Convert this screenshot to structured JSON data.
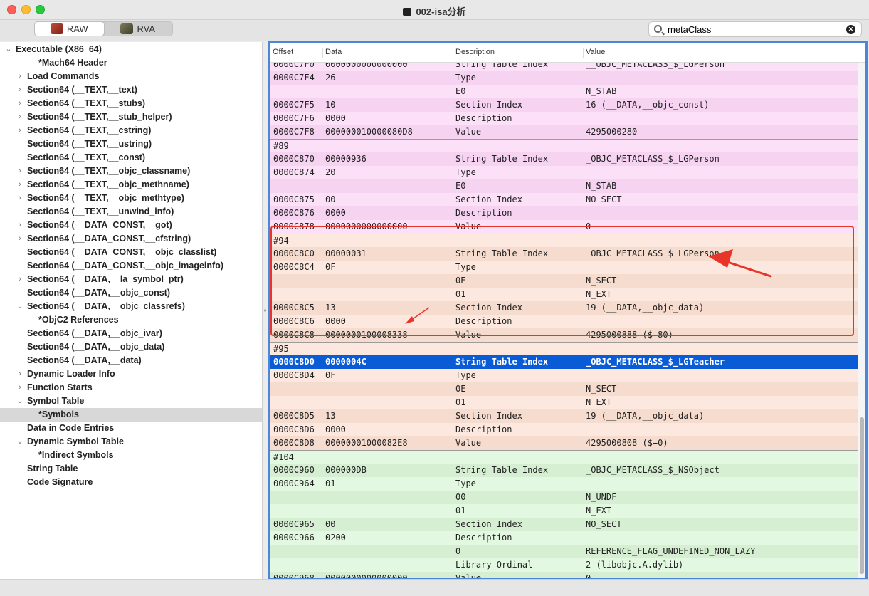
{
  "window": {
    "title": "002-isa分析"
  },
  "toolbar": {
    "raw_label": "RAW",
    "rva_label": "RVA",
    "search_value": "metaClass"
  },
  "columns": [
    "Offset",
    "Data",
    "Description",
    "Value"
  ],
  "sidebar": {
    "items": [
      {
        "label": "Executable  (X86_64)",
        "level": 0,
        "disc": "v"
      },
      {
        "label": "*Mach64 Header",
        "level": 2,
        "disc": ""
      },
      {
        "label": "Load Commands",
        "level": 1,
        "disc": ">"
      },
      {
        "label": "Section64 (__TEXT,__text)",
        "level": 1,
        "disc": ">"
      },
      {
        "label": "Section64 (__TEXT,__stubs)",
        "level": 1,
        "disc": ">"
      },
      {
        "label": "Section64 (__TEXT,__stub_helper)",
        "level": 1,
        "disc": ">"
      },
      {
        "label": "Section64 (__TEXT,__cstring)",
        "level": 1,
        "disc": ">"
      },
      {
        "label": "Section64 (__TEXT,__ustring)",
        "level": 1,
        "disc": ""
      },
      {
        "label": "Section64 (__TEXT,__const)",
        "level": 1,
        "disc": ""
      },
      {
        "label": "Section64 (__TEXT,__objc_classname)",
        "level": 1,
        "disc": ">"
      },
      {
        "label": "Section64 (__TEXT,__objc_methname)",
        "level": 1,
        "disc": ">"
      },
      {
        "label": "Section64 (__TEXT,__objc_methtype)",
        "level": 1,
        "disc": ">"
      },
      {
        "label": "Section64 (__TEXT,__unwind_info)",
        "level": 1,
        "disc": ""
      },
      {
        "label": "Section64 (__DATA_CONST,__got)",
        "level": 1,
        "disc": ">"
      },
      {
        "label": "Section64 (__DATA_CONST,__cfstring)",
        "level": 1,
        "disc": ">"
      },
      {
        "label": "Section64 (__DATA_CONST,__objc_classlist)",
        "level": 1,
        "disc": ""
      },
      {
        "label": "Section64 (__DATA_CONST,__objc_imageinfo)",
        "level": 1,
        "disc": ""
      },
      {
        "label": "Section64 (__DATA,__la_symbol_ptr)",
        "level": 1,
        "disc": ">"
      },
      {
        "label": "Section64 (__DATA,__objc_const)",
        "level": 1,
        "disc": ""
      },
      {
        "label": "Section64 (__DATA,__objc_classrefs)",
        "level": 1,
        "disc": "v"
      },
      {
        "label": "*ObjC2 References",
        "level": 2,
        "disc": ""
      },
      {
        "label": "Section64 (__DATA,__objc_ivar)",
        "level": 1,
        "disc": ""
      },
      {
        "label": "Section64 (__DATA,__objc_data)",
        "level": 1,
        "disc": ""
      },
      {
        "label": "Section64 (__DATA,__data)",
        "level": 1,
        "disc": ""
      },
      {
        "label": "Dynamic Loader Info",
        "level": 1,
        "disc": ">"
      },
      {
        "label": "Function Starts",
        "level": 1,
        "disc": ">"
      },
      {
        "label": "Symbol Table",
        "level": 1,
        "disc": "v"
      },
      {
        "label": "*Symbols",
        "level": 2,
        "disc": "",
        "selected": true
      },
      {
        "label": "Data in Code Entries",
        "level": 1,
        "disc": ""
      },
      {
        "label": "Dynamic Symbol Table",
        "level": 1,
        "disc": "v"
      },
      {
        "label": "*Indirect Symbols",
        "level": 2,
        "disc": ""
      },
      {
        "label": "String Table",
        "level": 1,
        "disc": ""
      },
      {
        "label": "Code Signature",
        "level": 1,
        "disc": ""
      }
    ]
  },
  "rows": [
    {
      "o": "0000C7F0",
      "d": "0000000000000000",
      "desc": "String Table Index",
      "v": "__OBJC_METACLASS_$_LGPerson",
      "bg": "pink"
    },
    {
      "o": "0000C7F4",
      "d": "26",
      "desc": "Type",
      "v": "",
      "bg": "pink"
    },
    {
      "o": "",
      "d": "",
      "desc": "E0",
      "v": "N_STAB",
      "bg": "pink"
    },
    {
      "o": "0000C7F5",
      "d": "10",
      "desc": "Section Index",
      "v": "16 (__DATA,__objc_const)",
      "bg": "pink"
    },
    {
      "o": "0000C7F6",
      "d": "0000",
      "desc": "Description",
      "v": "",
      "bg": "pink"
    },
    {
      "o": "0000C7F8",
      "d": "000000010000080D8",
      "desc": "Value",
      "v": "4295000280",
      "bg": "pink"
    },
    {
      "o": "#89",
      "d": "",
      "desc": "",
      "v": "",
      "bg": "pink",
      "sep": true
    },
    {
      "o": "0000C870",
      "d": "00000936",
      "desc": "String Table Index",
      "v": "_OBJC_METACLASS_$_LGPerson",
      "bg": "pink"
    },
    {
      "o": "0000C874",
      "d": "20",
      "desc": "Type",
      "v": "",
      "bg": "pink"
    },
    {
      "o": "",
      "d": "",
      "desc": "E0",
      "v": "N_STAB",
      "bg": "pink"
    },
    {
      "o": "0000C875",
      "d": "00",
      "desc": "Section Index",
      "v": "NO_SECT",
      "bg": "pink"
    },
    {
      "o": "0000C876",
      "d": "0000",
      "desc": "Description",
      "v": "",
      "bg": "pink"
    },
    {
      "o": "0000C878",
      "d": "0000000000000000",
      "desc": "Value",
      "v": "0",
      "bg": "pink"
    },
    {
      "o": "#94",
      "d": "",
      "desc": "",
      "v": "",
      "bg": "peach",
      "sep": true
    },
    {
      "o": "0000C8C0",
      "d": "00000031",
      "desc": "String Table Index",
      "v": "_OBJC_METACLASS_$_LGPerson",
      "bg": "peach"
    },
    {
      "o": "0000C8C4",
      "d": "0F",
      "desc": "Type",
      "v": "",
      "bg": "peach"
    },
    {
      "o": "",
      "d": "",
      "desc": "0E",
      "v": "N_SECT",
      "bg": "peach"
    },
    {
      "o": "",
      "d": "",
      "desc": "01",
      "v": "N_EXT",
      "bg": "peach"
    },
    {
      "o": "0000C8C5",
      "d": "13",
      "desc": "Section Index",
      "v": "19 (__DATA,__objc_data)",
      "bg": "peach"
    },
    {
      "o": "0000C8C6",
      "d": "0000",
      "desc": "Description",
      "v": "",
      "bg": "peach"
    },
    {
      "o": "0000C8C8",
      "d": "0000000100008338",
      "desc": "Value",
      "v": "4295000888 ($+80)",
      "bg": "peach"
    },
    {
      "o": "#95",
      "d": "",
      "desc": "",
      "v": "",
      "bg": "peach",
      "sep": true
    },
    {
      "o": "0000C8D0",
      "d": "0000004C",
      "desc": "String Table Index",
      "v": "_OBJC_METACLASS_$_LGTeacher",
      "bg": "peach",
      "selected": true
    },
    {
      "o": "0000C8D4",
      "d": "0F",
      "desc": "Type",
      "v": "",
      "bg": "peach"
    },
    {
      "o": "",
      "d": "",
      "desc": "0E",
      "v": "N_SECT",
      "bg": "peach"
    },
    {
      "o": "",
      "d": "",
      "desc": "01",
      "v": "N_EXT",
      "bg": "peach"
    },
    {
      "o": "0000C8D5",
      "d": "13",
      "desc": "Section Index",
      "v": "19 (__DATA,__objc_data)",
      "bg": "peach"
    },
    {
      "o": "0000C8D6",
      "d": "0000",
      "desc": "Description",
      "v": "",
      "bg": "peach"
    },
    {
      "o": "0000C8D8",
      "d": "00000001000082E8",
      "desc": "Value",
      "v": "4295000808 ($+0)",
      "bg": "peach"
    },
    {
      "o": "#104",
      "d": "",
      "desc": "",
      "v": "",
      "bg": "green",
      "sep": true
    },
    {
      "o": "0000C960",
      "d": "000000DB",
      "desc": "String Table Index",
      "v": "_OBJC_METACLASS_$_NSObject",
      "bg": "green"
    },
    {
      "o": "0000C964",
      "d": "01",
      "desc": "Type",
      "v": "",
      "bg": "green"
    },
    {
      "o": "",
      "d": "",
      "desc": "00",
      "v": "N_UNDF",
      "bg": "green"
    },
    {
      "o": "",
      "d": "",
      "desc": "01",
      "v": "N_EXT",
      "bg": "green"
    },
    {
      "o": "0000C965",
      "d": "00",
      "desc": "Section Index",
      "v": "NO_SECT",
      "bg": "green"
    },
    {
      "o": "0000C966",
      "d": "0200",
      "desc": "Description",
      "v": "",
      "bg": "green"
    },
    {
      "o": "",
      "d": "",
      "desc": "0",
      "v": "REFERENCE_FLAG_UNDEFINED_NON_LAZY",
      "bg": "green"
    },
    {
      "o": "",
      "d": "",
      "desc": "Library Ordinal",
      "v": "2 (libobjc.A.dylib)",
      "bg": "green"
    },
    {
      "o": "0000C968",
      "d": "0000000000000000",
      "desc": "Value",
      "v": "0",
      "bg": "green"
    }
  ],
  "colors": {
    "accent": "#4a87d9",
    "selection": "#0a5bd6",
    "annotation": "#e8352a"
  }
}
